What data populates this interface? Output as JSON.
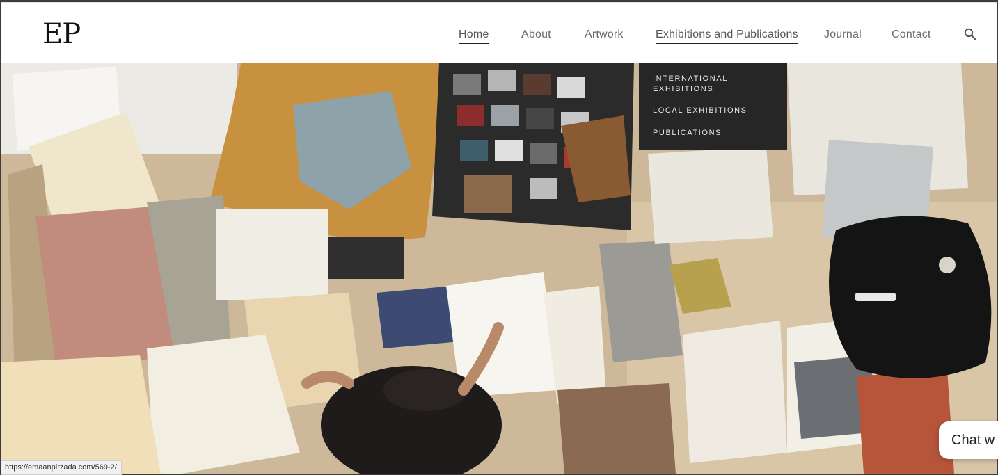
{
  "site": {
    "logo": "EP"
  },
  "nav": {
    "items": [
      {
        "label": "Home",
        "active": true
      },
      {
        "label": "About",
        "active": false
      },
      {
        "label": "Artwork",
        "active": false
      },
      {
        "label": "Exhibitions and Publications",
        "active": true
      },
      {
        "label": "Journal",
        "active": false
      },
      {
        "label": "Contact",
        "active": false
      }
    ],
    "search_icon": "search-icon"
  },
  "dropdown": {
    "items": [
      "INTERNATIONAL EXHIBITIONS",
      "LOCAL EXHIBITIONS",
      "PUBLICATIONS"
    ]
  },
  "chat": {
    "label": "Chat w"
  },
  "status_bar": {
    "url": "https://emaanpirzada.com/569-2/"
  },
  "colors": {
    "dropdown_bg": "#262626",
    "nav_text": "#6a6a6a",
    "header_bg": "#ffffff"
  }
}
